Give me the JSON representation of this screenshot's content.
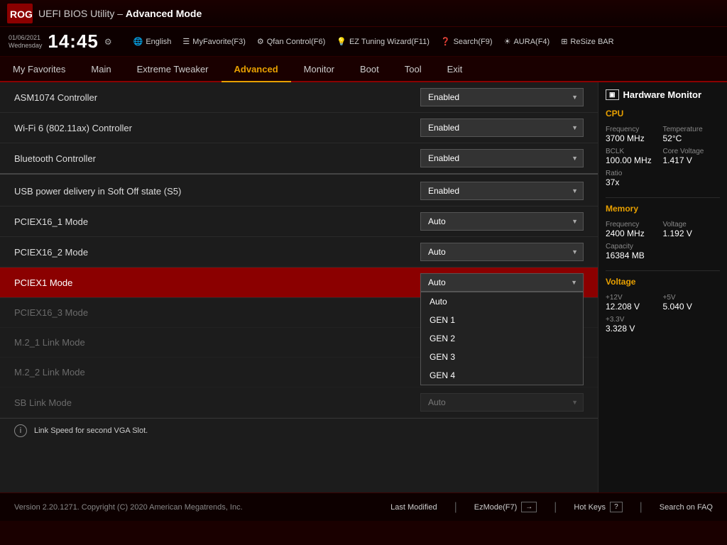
{
  "header": {
    "title_prefix": "UEFI BIOS Utility – ",
    "title_mode": "Advanced Mode"
  },
  "clockbar": {
    "date": "01/06/2021",
    "day": "Wednesday",
    "time": "14:45",
    "items": [
      {
        "label": "English",
        "icon": "🌐"
      },
      {
        "label": "MyFavorite(F3)",
        "icon": "☰"
      },
      {
        "label": "Qfan Control(F6)",
        "icon": "⚙"
      },
      {
        "label": "EZ Tuning Wizard(F11)",
        "icon": "💡"
      },
      {
        "label": "Search(F9)",
        "icon": "❓"
      },
      {
        "label": "AURA(F4)",
        "icon": "☀"
      },
      {
        "label": "ReSize BAR",
        "icon": "⊞"
      }
    ]
  },
  "nav": {
    "items": [
      {
        "label": "My Favorites",
        "active": false
      },
      {
        "label": "Main",
        "active": false
      },
      {
        "label": "Extreme Tweaker",
        "active": false
      },
      {
        "label": "Advanced",
        "active": true
      },
      {
        "label": "Monitor",
        "active": false
      },
      {
        "label": "Boot",
        "active": false
      },
      {
        "label": "Tool",
        "active": false
      },
      {
        "label": "Exit",
        "active": false
      }
    ]
  },
  "settings": [
    {
      "label": "ASM1074 Controller",
      "value": "Enabled",
      "type": "dropdown",
      "separator": false
    },
    {
      "label": "Wi-Fi 6 (802.11ax) Controller",
      "value": "Enabled",
      "type": "dropdown",
      "separator": false
    },
    {
      "label": "Bluetooth Controller",
      "value": "Enabled",
      "type": "dropdown",
      "separator": true
    },
    {
      "label": "USB power delivery in Soft Off state (S5)",
      "value": "Enabled",
      "type": "dropdown",
      "separator": false
    },
    {
      "label": "PCIEX16_1 Mode",
      "value": "Auto",
      "type": "dropdown",
      "separator": false
    },
    {
      "label": "PCIEX16_2 Mode",
      "value": "Auto",
      "type": "dropdown",
      "separator": false
    },
    {
      "label": "PCIEX1 Mode",
      "value": "Auto",
      "type": "dropdown",
      "active": true,
      "separator": false
    },
    {
      "label": "PCIEX16_3 Mode",
      "value": "",
      "type": "none",
      "separator": false
    },
    {
      "label": "M.2_1 Link Mode",
      "value": "",
      "type": "none",
      "separator": false
    },
    {
      "label": "M.2_2 Link Mode",
      "value": "",
      "type": "none",
      "separator": false
    },
    {
      "label": "SB Link Mode",
      "value": "Auto",
      "type": "dropdown",
      "separator": false
    }
  ],
  "dropdown_options": [
    "Auto",
    "GEN 1",
    "GEN 2",
    "GEN 3",
    "GEN 4"
  ],
  "status_bar": {
    "text": "Link Speed for second VGA Slot."
  },
  "hw_monitor": {
    "title": "Hardware Monitor",
    "sections": [
      {
        "title": "CPU",
        "rows": [
          {
            "col1_label": "Frequency",
            "col1_value": "3700 MHz",
            "col2_label": "Temperature",
            "col2_value": "52°C"
          },
          {
            "col1_label": "BCLK",
            "col1_value": "100.00 MHz",
            "col2_label": "Core Voltage",
            "col2_value": "1.417 V"
          },
          {
            "col1_label": "Ratio",
            "col1_value": "37x",
            "col2_label": "",
            "col2_value": ""
          }
        ]
      },
      {
        "title": "Memory",
        "rows": [
          {
            "col1_label": "Frequency",
            "col1_value": "2400 MHz",
            "col2_label": "Voltage",
            "col2_value": "1.192 V"
          },
          {
            "col1_label": "Capacity",
            "col1_value": "16384 MB",
            "col2_label": "",
            "col2_value": ""
          }
        ]
      },
      {
        "title": "Voltage",
        "rows": [
          {
            "col1_label": "+12V",
            "col1_value": "12.208 V",
            "col2_label": "+5V",
            "col2_value": "5.040 V"
          },
          {
            "col1_label": "+3.3V",
            "col1_value": "3.328 V",
            "col2_label": "",
            "col2_value": ""
          }
        ]
      }
    ]
  },
  "footer": {
    "version": "Version 2.20.1271. Copyright (C) 2020 American Megatrends, Inc.",
    "last_modified": "Last Modified",
    "ez_mode": "EzMode(F7)",
    "ez_icon": "→",
    "hot_keys": "Hot Keys",
    "hot_keys_icon": "?",
    "search": "Search on FAQ"
  }
}
